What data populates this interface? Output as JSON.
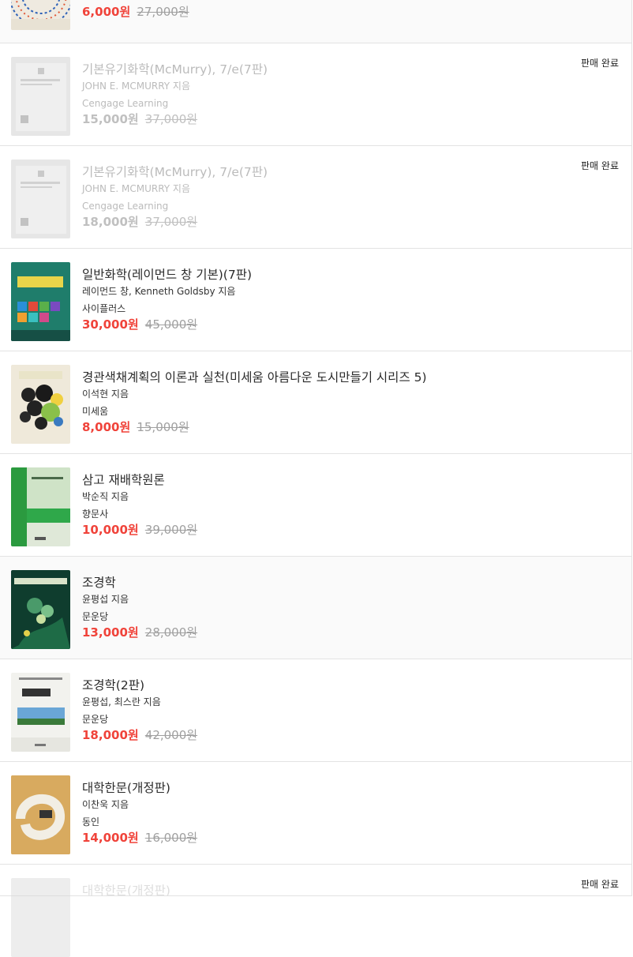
{
  "items": [
    {
      "title": "",
      "author": "",
      "publisher": "",
      "price": "6,000원",
      "original_price": "27,000원",
      "status": ""
    },
    {
      "title": "기본유기화학(McMurry), 7/e(7판)",
      "author": "JOHN E. MCMURRY 지음",
      "publisher": "Cengage Learning",
      "price": "15,000원",
      "original_price": "37,000원",
      "status": "판매 완료"
    },
    {
      "title": "기본유기화학(McMurry), 7/e(7판)",
      "author": "JOHN E. MCMURRY 지음",
      "publisher": "Cengage Learning",
      "price": "18,000원",
      "original_price": "37,000원",
      "status": "판매 완료"
    },
    {
      "title": "일반화학(레이먼드 창 기본)(7판)",
      "author": "레이먼드 창, Kenneth Goldsby 지음",
      "publisher": "사이플러스",
      "price": "30,000원",
      "original_price": "45,000원",
      "status": ""
    },
    {
      "title": "경관색채계획의 이론과 실천(미세움 아름다운 도시만들기 시리즈 5)",
      "author": "이석현 지음",
      "publisher": "미세움",
      "price": "8,000원",
      "original_price": "15,000원",
      "status": ""
    },
    {
      "title": "삼고 재배학원론",
      "author": "박순직 지음",
      "publisher": "향문사",
      "price": "10,000원",
      "original_price": "39,000원",
      "status": ""
    },
    {
      "title": "조경학",
      "author": "윤평섭 지음",
      "publisher": "문운당",
      "price": "13,000원",
      "original_price": "28,000원",
      "status": ""
    },
    {
      "title": "조경학(2판)",
      "author": "윤평섭, 최스란 지음",
      "publisher": "문운당",
      "price": "18,000원",
      "original_price": "42,000원",
      "status": ""
    },
    {
      "title": "대학한문(개정판)",
      "author": "이찬욱 지음",
      "publisher": "동인",
      "price": "14,000원",
      "original_price": "16,000원",
      "status": ""
    },
    {
      "title": "대학한문(개정판)",
      "author": "",
      "publisher": "",
      "price": "",
      "original_price": "",
      "status": "판매 완료"
    }
  ]
}
